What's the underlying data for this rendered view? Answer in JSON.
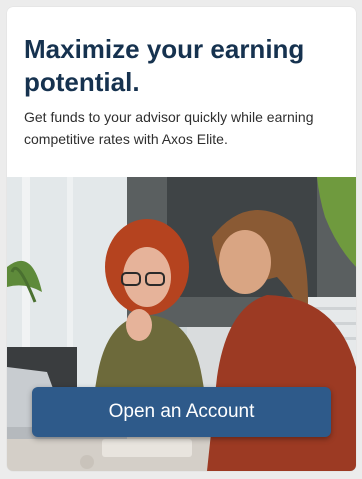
{
  "promo": {
    "headline": "Maximize your earning potential.",
    "description": "Get funds to your advisor quickly while earning competitive rates with Axos Elite.",
    "cta_label": "Open an Account"
  },
  "colors": {
    "headline": "#16324f",
    "button": "#2e5a8a",
    "button_text": "#ffffff"
  }
}
